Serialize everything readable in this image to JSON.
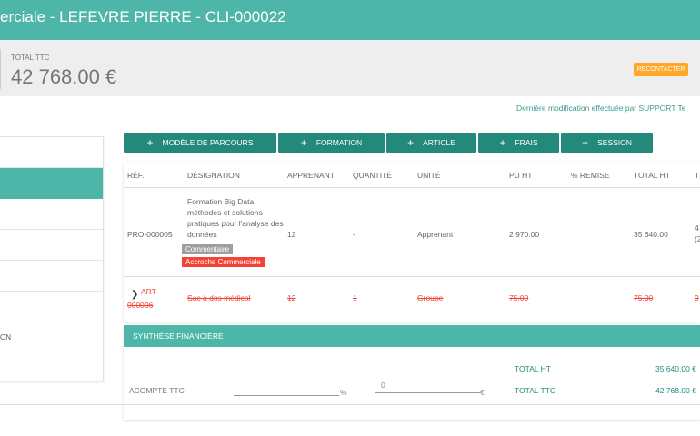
{
  "header": {
    "title": "erciale - LEFEVRE PIERRE - CLI-000022"
  },
  "summary": {
    "total_label": "TOTAL TTC",
    "total_value": "42 768.00 €",
    "status_badge": "RECONTACTER"
  },
  "last_modified": "Dernière modification effectuée par SUPPORT Te",
  "sidebar": {
    "items": [
      "",
      "",
      "",
      "",
      "",
      "",
      "ON"
    ],
    "active_index": 1
  },
  "toolbar": {
    "buttons": [
      "MODÈLE DE PARCOURS",
      "FORMATION",
      "ARTICLE",
      "FRAIS",
      "SESSION"
    ]
  },
  "table": {
    "headers": [
      "RÉF.",
      "DÉSIGNATION",
      "APPRENANT",
      "QUANTITÉ",
      "UNITÉ",
      "PU HT",
      "% REMISE",
      "TOTAL HT",
      "T"
    ],
    "row1": {
      "ref": "PRO-000005",
      "designation": "Formation Big Data, méthodes et solutions pratiques pour l'analyse des données",
      "tag_comment": "Commentaire",
      "tag_accroche": "Accroche Commerciale",
      "apprenant": "12",
      "quantite": "-",
      "unite": "Apprenant",
      "pu_ht": "2 970.00",
      "remise": "",
      "total_ht": "35 640.00",
      "ttc_a": "4",
      "ttc_b": "(2"
    },
    "row2": {
      "ref_a": "ART-",
      "ref_b": "000006",
      "designation": "Sac à dos médical",
      "apprenant": "12",
      "quantite": "1",
      "unite": "Groupe",
      "pu_ht": "75.00",
      "total_ht": "75.00",
      "ttc": "9"
    }
  },
  "synthese": {
    "title": "SYNTHÈSE FINANCIÈRE",
    "acompte_label": "ACOMPTE TTC",
    "percent_unit": "%",
    "amount_value": "0",
    "euro_unit": "€",
    "total_ht_label": "TOTAL HT",
    "total_ht_value": "35 640.00 €",
    "total_ttc_label": "TOTAL TTC",
    "total_ttc_value": "42 768.00 €"
  },
  "colors": {
    "primary": "#4db6a8",
    "button": "#23897b",
    "badge": "#ffa726",
    "tag_red": "#f44336",
    "tag_grey": "#9e9e9e"
  }
}
